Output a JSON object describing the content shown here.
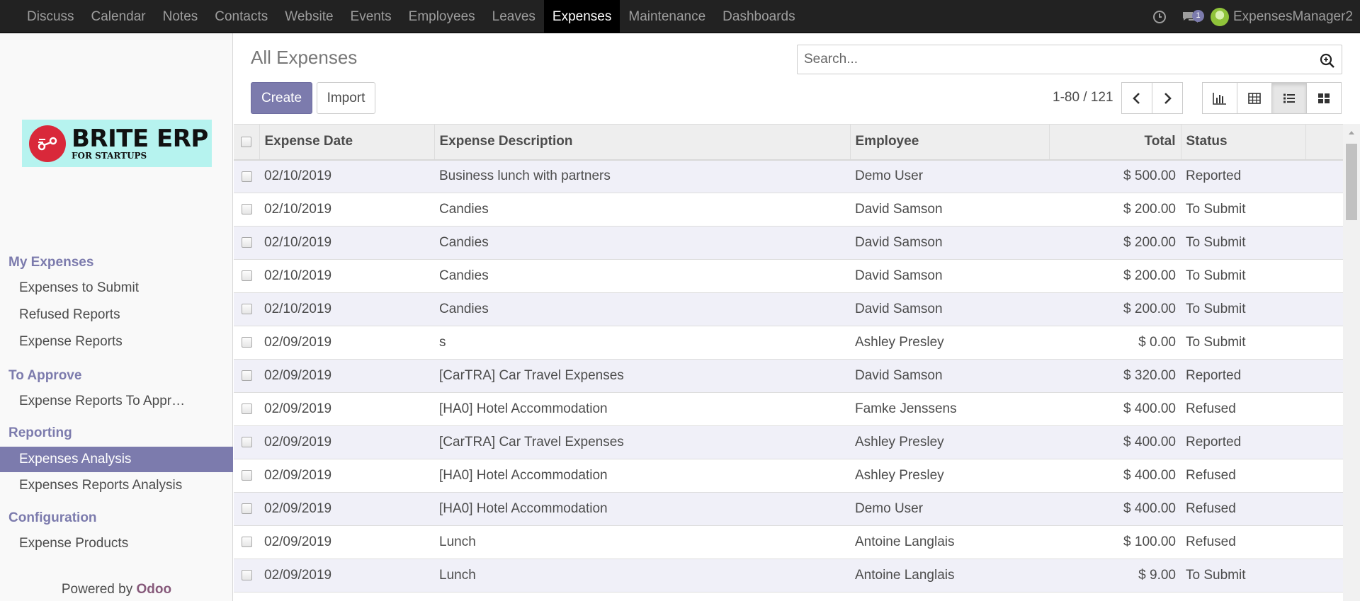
{
  "navbar": {
    "apps": [
      {
        "label": "Discuss"
      },
      {
        "label": "Calendar"
      },
      {
        "label": "Notes"
      },
      {
        "label": "Contacts"
      },
      {
        "label": "Website"
      },
      {
        "label": "Events"
      },
      {
        "label": "Employees"
      },
      {
        "label": "Leaves"
      },
      {
        "label": "Expenses",
        "active": true
      },
      {
        "label": "Maintenance"
      },
      {
        "label": "Dashboards"
      }
    ],
    "message_count": "1",
    "user_name": "ExpensesManager2"
  },
  "sidebar": {
    "logo": {
      "main": "BRITE ERP",
      "sub": "FOR STARTUPS"
    },
    "sections": [
      {
        "title": "My Expenses",
        "items": [
          "Expenses to Submit",
          "Refused Reports",
          "Expense Reports"
        ]
      },
      {
        "title": "To Approve",
        "items": [
          "Expense Reports To Appr…"
        ]
      },
      {
        "title": "Reporting",
        "items": [
          "Expenses Analysis",
          "Expenses Reports Analysis"
        ]
      },
      {
        "title": "Configuration",
        "items": [
          "Expense Products"
        ]
      }
    ],
    "active_item": "Expenses Analysis",
    "powered_by": "Powered by",
    "powered_brand": "Odoo"
  },
  "control_panel": {
    "title": "All Expenses",
    "search_placeholder": "Search...",
    "create_label": "Create",
    "import_label": "Import",
    "pager": "1-80 / 121"
  },
  "table": {
    "columns": [
      "Expense Date",
      "Expense Description",
      "Employee",
      "Total",
      "Status"
    ],
    "rows": [
      [
        "02/10/2019",
        "Business lunch with partners",
        "Demo User",
        "$ 500.00",
        "Reported"
      ],
      [
        "02/10/2019",
        "Candies",
        "David Samson",
        "$ 200.00",
        "To Submit"
      ],
      [
        "02/10/2019",
        "Candies",
        "David Samson",
        "$ 200.00",
        "To Submit"
      ],
      [
        "02/10/2019",
        "Candies",
        "David Samson",
        "$ 200.00",
        "To Submit"
      ],
      [
        "02/10/2019",
        "Candies",
        "David Samson",
        "$ 200.00",
        "To Submit"
      ],
      [
        "02/09/2019",
        "s",
        "Ashley Presley",
        "$ 0.00",
        "To Submit"
      ],
      [
        "02/09/2019",
        "[CarTRA] Car Travel Expenses",
        "David Samson",
        "$ 320.00",
        "Reported"
      ],
      [
        "02/09/2019",
        "[HA0] Hotel Accommodation",
        "Famke Jenssens",
        "$ 400.00",
        "Refused"
      ],
      [
        "02/09/2019",
        "[CarTRA] Car Travel Expenses",
        "Ashley Presley",
        "$ 400.00",
        "Reported"
      ],
      [
        "02/09/2019",
        "[HA0] Hotel Accommodation",
        "Ashley Presley",
        "$ 400.00",
        "Refused"
      ],
      [
        "02/09/2019",
        "[HA0] Hotel Accommodation",
        "Demo User",
        "$ 400.00",
        "Refused"
      ],
      [
        "02/09/2019",
        "Lunch",
        "Antoine Langlais",
        "$ 100.00",
        "Refused"
      ],
      [
        "02/09/2019",
        "Lunch",
        "Antoine Langlais",
        "$ 9.00",
        "To Submit"
      ]
    ]
  },
  "colors": {
    "brand": "#7c7bad",
    "navbar": "#222222",
    "odoo": "#875a7b"
  }
}
